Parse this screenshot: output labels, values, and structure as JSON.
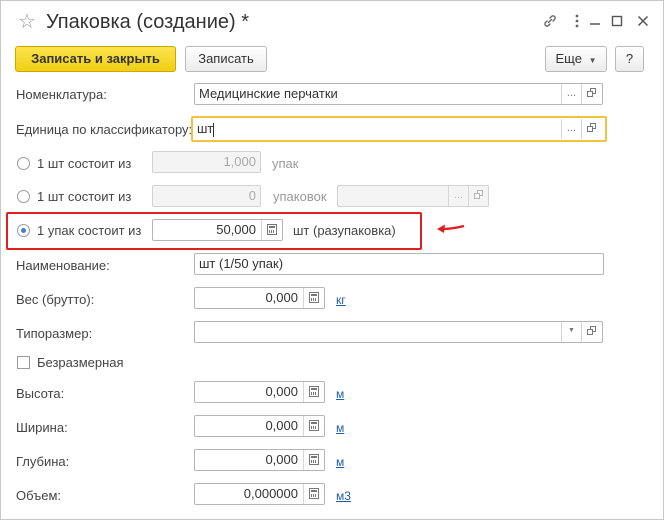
{
  "window": {
    "title": "Упаковка (создание) *"
  },
  "toolbar": {
    "save_close_label": "Записать и закрыть",
    "save_label": "Записать",
    "more_label": "Еще",
    "help_label": "?"
  },
  "form": {
    "nomenclature": {
      "label": "Номенклатура:",
      "value": "Медицинские перчатки"
    },
    "unit": {
      "label": "Единица по классификатору:",
      "value": "шт"
    },
    "radio1": {
      "label": "1 шт состоит из",
      "value": "1,000",
      "unit": "упак"
    },
    "radio2": {
      "label": "1 шт состоит из",
      "value": "0",
      "unit": "упаковок",
      "package_value": ""
    },
    "radio3": {
      "label": "1 упак состоит из",
      "value": "50,000",
      "unit": "шт (разупаковка)"
    },
    "name": {
      "label": "Наименование:",
      "value": "шт (1/50 упак)"
    },
    "weight": {
      "label": "Вес (брутто):",
      "value": "0,000",
      "unit": "кг"
    },
    "size_type": {
      "label": "Типоразмер:",
      "value": ""
    },
    "dimensionless": {
      "label": "Безразмерная"
    },
    "height": {
      "label": "Высота:",
      "value": "0,000",
      "unit": "м"
    },
    "width": {
      "label": "Ширина:",
      "value": "0,000",
      "unit": "м"
    },
    "depth": {
      "label": "Глубина:",
      "value": "0,000",
      "unit": "м"
    },
    "volume": {
      "label": "Объем:",
      "value": "0,000000",
      "unit": "м3"
    }
  },
  "colors": {
    "highlight": "#e02020",
    "primary_button": "#f5d320",
    "link": "#1f5fa8"
  }
}
